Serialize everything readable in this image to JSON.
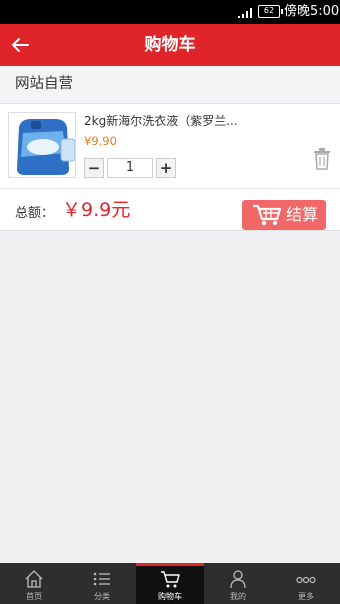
{
  "statusbar": {
    "battery": "62",
    "time": "傍晚5:00"
  },
  "header": {
    "title": "购物车"
  },
  "section": {
    "title": "网站自营"
  },
  "item": {
    "name": "2kg新海尔洗衣液（紫罗兰...",
    "price": "¥9.90",
    "quantity": "1",
    "minus_label": "−",
    "plus_label": "+"
  },
  "total": {
    "label": "总额：",
    "amount": "￥9.9元"
  },
  "checkout": {
    "label": "结算"
  },
  "tabs": [
    {
      "label": "首页",
      "icon": "home-icon"
    },
    {
      "label": "分类",
      "icon": "list-icon"
    },
    {
      "label": "购物车",
      "icon": "cart-icon"
    },
    {
      "label": "我的",
      "icon": "user-icon"
    },
    {
      "label": "更多",
      "icon": "more-icon"
    }
  ],
  "colors": {
    "brand": "#e0252a",
    "price": "#e47b1f",
    "checkout": "#f26767"
  }
}
